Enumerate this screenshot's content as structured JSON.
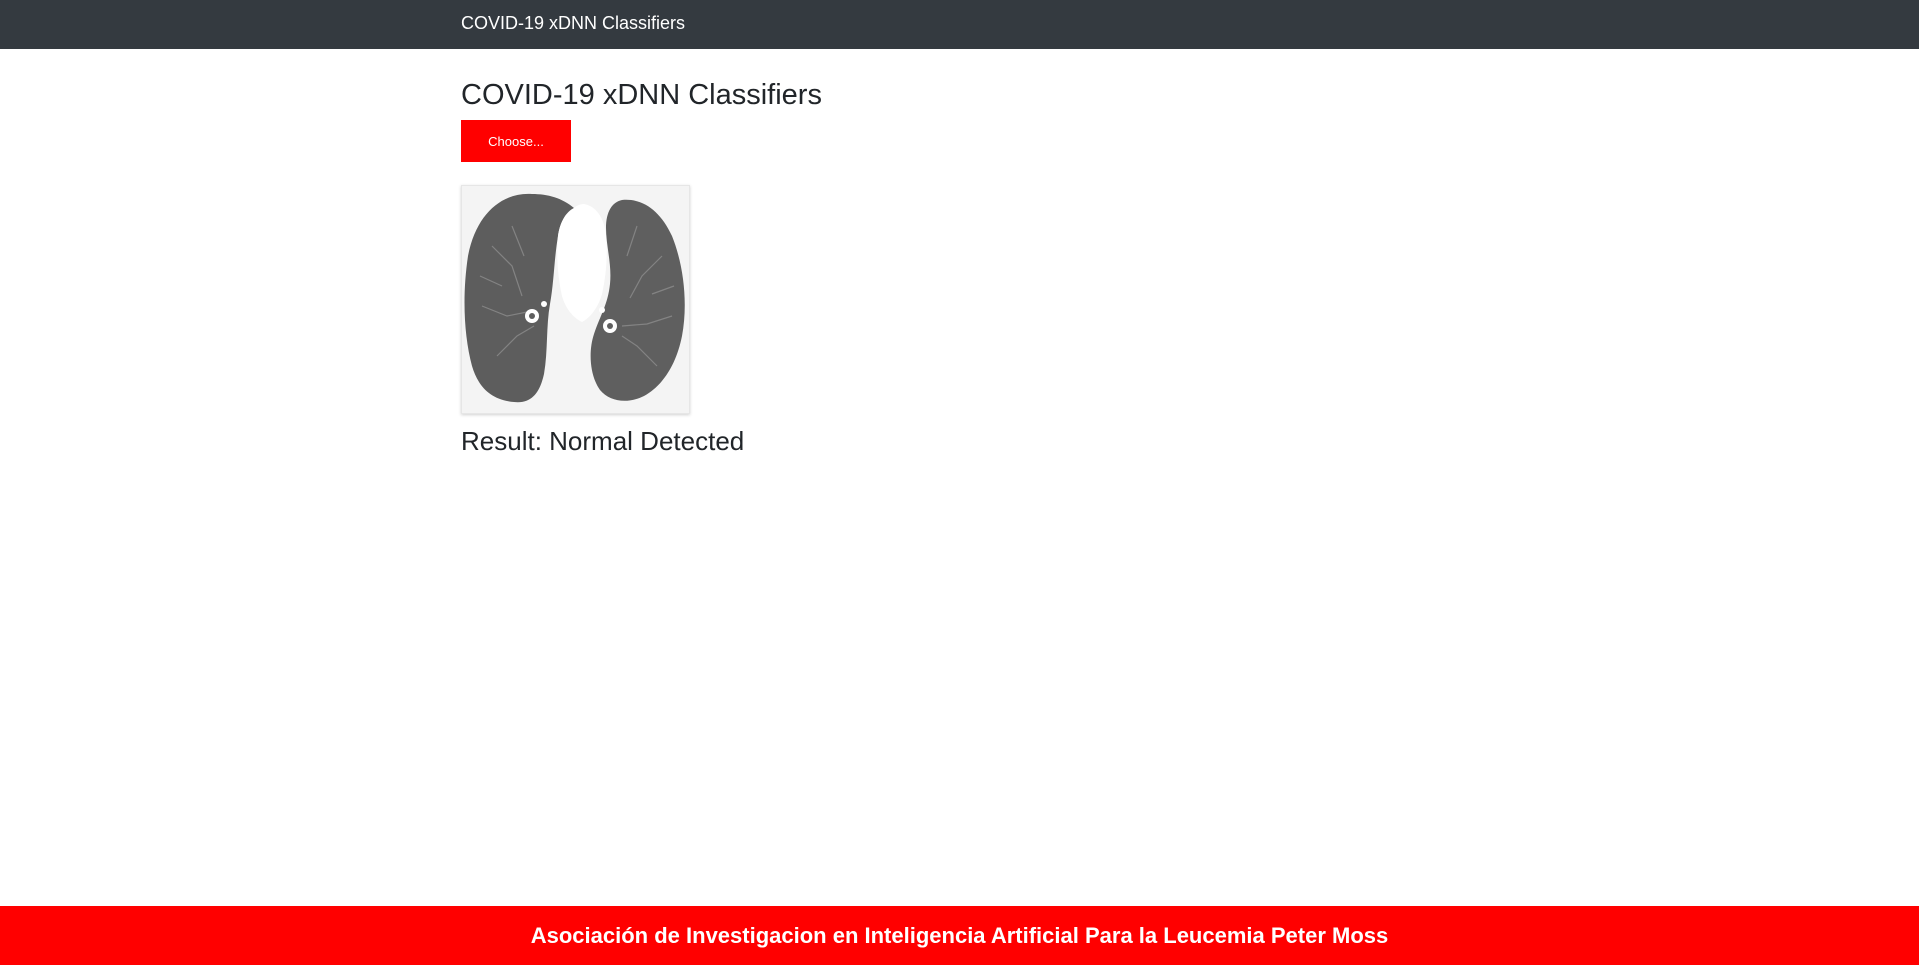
{
  "navbar": {
    "brand": "COVID-19 xDNN Classifiers"
  },
  "main": {
    "title": "COVID-19 xDNN Classifiers",
    "choose_button_label": "Choose...",
    "preview_image": {
      "alt": "Lung CT scan",
      "icon": "lung-ct-scan-image"
    },
    "result_label": "Result:",
    "result_value": "Normal Detected"
  },
  "footer": {
    "text": "Asociación de Investigacion en Inteligencia Artificial Para la Leucemia Peter Moss"
  },
  "colors": {
    "navbar_bg": "#343a40",
    "accent": "#ff0000",
    "text": "#212529"
  }
}
